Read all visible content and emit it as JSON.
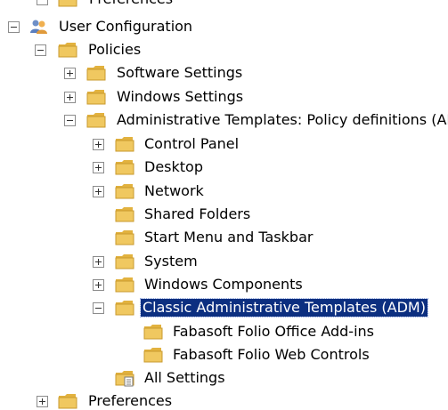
{
  "tree": {
    "top_partial_label": "Preferences",
    "user_configuration": "User Configuration",
    "policies": "Policies",
    "software_settings": "Software Settings",
    "windows_settings": "Windows Settings",
    "admin_templates": "Administrative Templates: Policy definitions (AD",
    "control_panel": "Control Panel",
    "desktop": "Desktop",
    "network": "Network",
    "shared_folders": "Shared Folders",
    "start_menu": "Start Menu and Taskbar",
    "system": "System",
    "windows_components": "Windows Components",
    "classic_admin_templates": "Classic Administrative Templates (ADM)",
    "fabasoft_office": "Fabasoft Folio Office Add-ins",
    "fabasoft_web": "Fabasoft Folio Web Controls",
    "all_settings": "All Settings",
    "preferences": "Preferences"
  },
  "colors": {
    "selection_background": "#0c2f80",
    "folder_body": "#f0c860",
    "folder_tab": "#e2b23f"
  }
}
